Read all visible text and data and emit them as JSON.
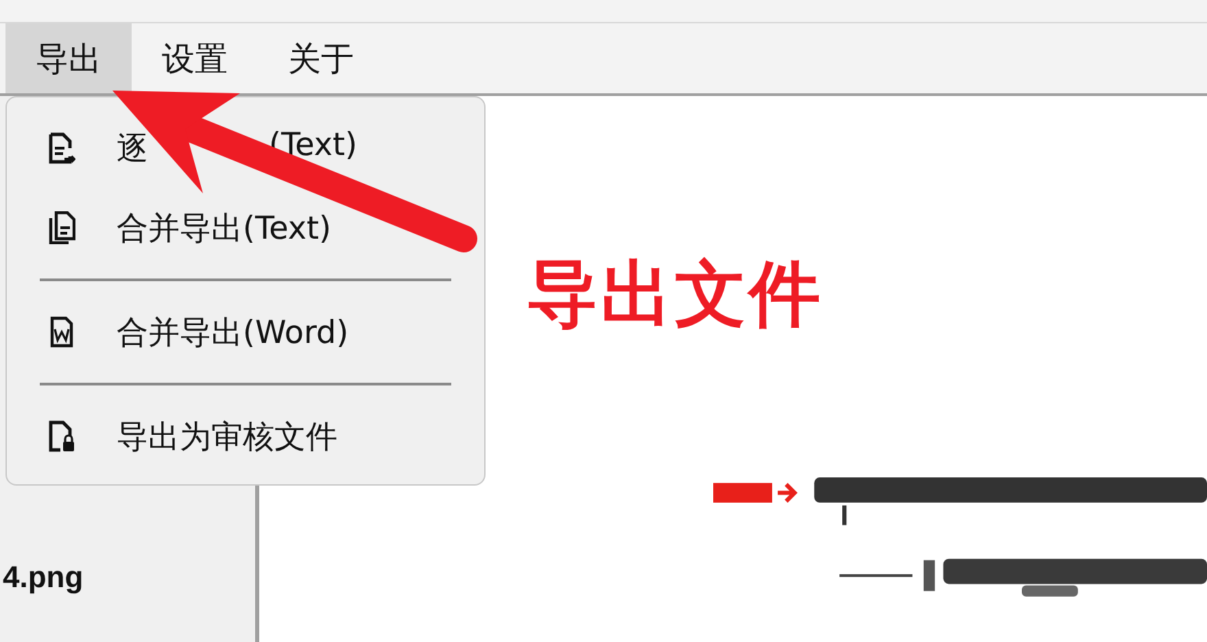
{
  "menubar": [
    {
      "label": "导出",
      "selected": true
    },
    {
      "label": "设置",
      "selected": false
    },
    {
      "label": "关于",
      "selected": false
    }
  ],
  "sidebar": {
    "items": [
      {
        "label": "4.png"
      }
    ]
  },
  "export_menu": {
    "items": [
      {
        "kind": "export-each",
        "texts": [
          "逐",
          "(Text)"
        ]
      },
      {
        "kind": "merge",
        "texts": [
          "合并导出(Text)"
        ]
      },
      {
        "kind": "separator"
      },
      {
        "kind": "word",
        "texts": [
          "合并导出(Word)"
        ]
      },
      {
        "kind": "separator"
      },
      {
        "kind": "review",
        "texts": [
          "导出为审核文件"
        ]
      }
    ]
  },
  "annotation": {
    "label": "导出文件"
  }
}
